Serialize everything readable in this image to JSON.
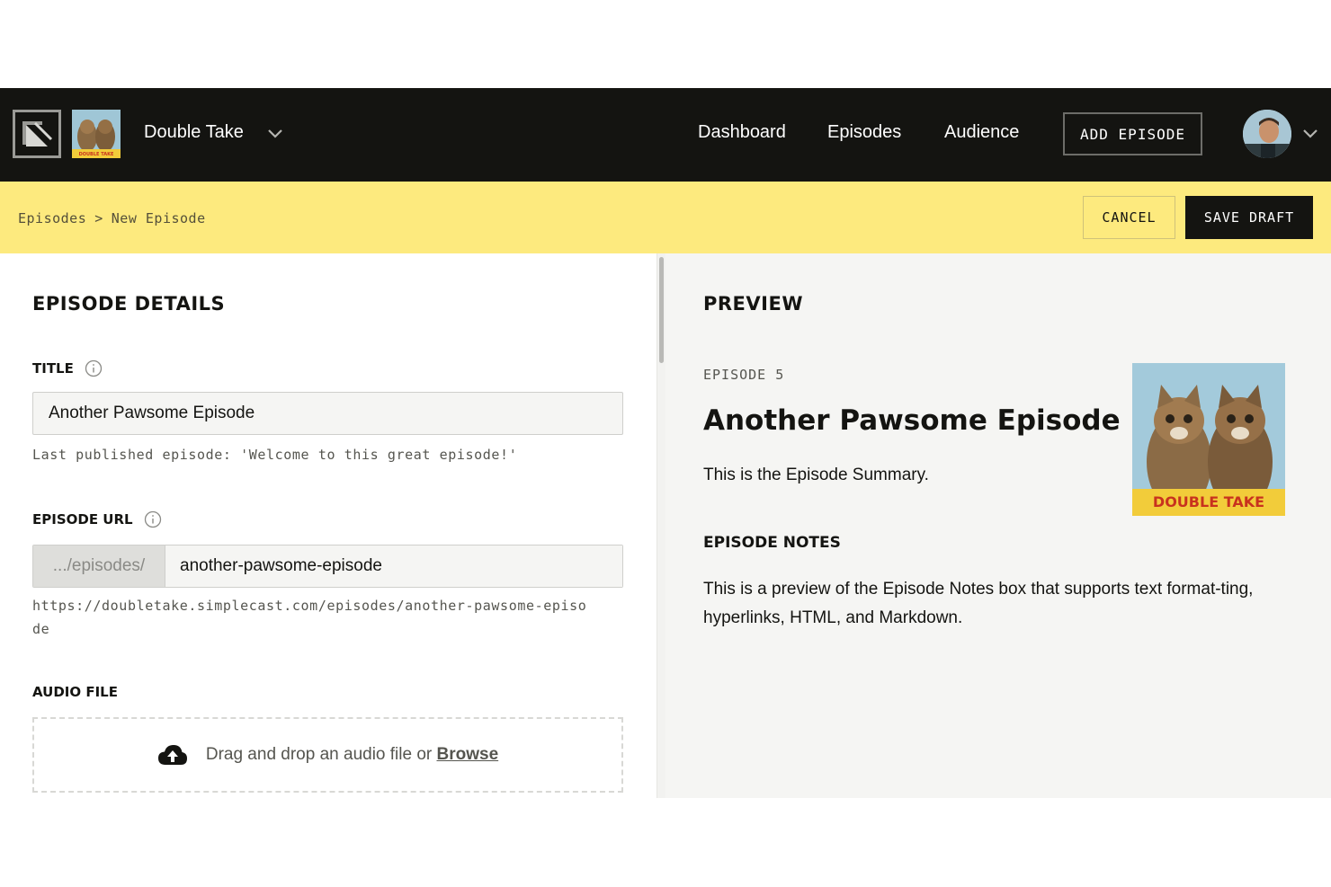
{
  "app": {
    "show_name": "Double Take",
    "show_art_text": "DOUBLE TAKE"
  },
  "nav": {
    "items": [
      {
        "label": "Dashboard"
      },
      {
        "label": "Episodes"
      },
      {
        "label": "Audience"
      }
    ],
    "add_episode_label": "ADD EPISODE"
  },
  "breadcrumb": {
    "parent": "Episodes",
    "separator": ">",
    "current": "New Episode"
  },
  "actions": {
    "cancel_label": "CANCEL",
    "save_label": "SAVE DRAFT"
  },
  "details": {
    "heading": "EPISODE DETAILS",
    "title_label": "TITLE",
    "title_value": "Another Pawsome Episode",
    "last_published": "Last published episode: 'Welcome to this great episode!'",
    "url_label": "EPISODE URL",
    "url_prefix": ".../episodes/",
    "url_slug": "another-pawsome-episode",
    "url_full_line1": "https://doubletake.simplecast.com/episodes/another-pawsome-episo",
    "url_full_line2": "de",
    "audio_label": "AUDIO FILE",
    "drop_text": "Drag and drop an audio file or",
    "browse_label": "Browse"
  },
  "preview": {
    "heading": "PREVIEW",
    "episode_number": "EPISODE 5",
    "title": "Another Pawsome Episode",
    "summary": "This is the Episode Summary.",
    "art_text": "DOUBLE TAKE",
    "notes_heading": "EPISODE NOTES",
    "notes_body": "This is a preview of the Episode Notes box that supports text format-ting, hyperlinks, HTML, and Markdown."
  },
  "colors": {
    "nav_bg": "#141411",
    "accent_yellow": "#fdea7e",
    "preview_bg": "#f5f5f3"
  }
}
